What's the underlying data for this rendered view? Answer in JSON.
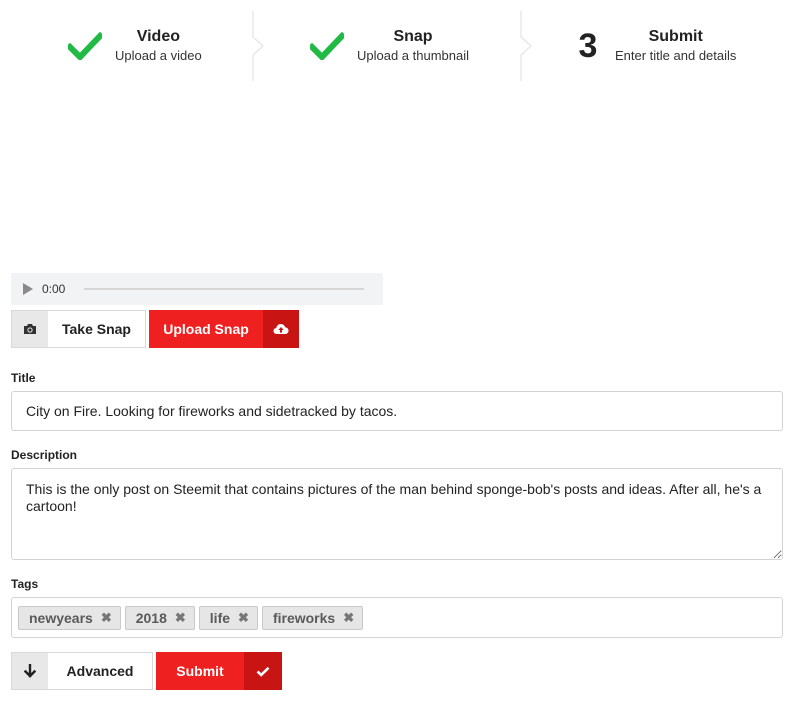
{
  "steps": [
    {
      "icon": "checkmark-icon",
      "title": "Video",
      "description": "Upload a video",
      "completed": true
    },
    {
      "icon": "checkmark-icon",
      "title": "Snap",
      "description": "Upload a thumbnail",
      "completed": true
    },
    {
      "number": "3",
      "title": "Submit",
      "description": "Enter title and details",
      "completed": false
    }
  ],
  "player": {
    "time": "0:00",
    "progress": 0
  },
  "snap": {
    "take_label": "Take Snap",
    "take_icon": "camera-icon",
    "upload_label": "Upload Snap",
    "upload_icon": "cloud-upload-icon"
  },
  "form": {
    "title_label": "Title",
    "title_value": "City on Fire. Looking for fireworks and sidetracked by tacos.",
    "description_label": "Description",
    "description_value": "This is the only post on Steemit that contains pictures of the man behind sponge-bob's posts and ideas. After all, he's a cartoon!",
    "tags_label": "Tags",
    "tags": [
      "newyears",
      "2018",
      "life",
      "fireworks"
    ]
  },
  "actions": {
    "advanced_label": "Advanced",
    "advanced_icon": "arrow-down-icon",
    "submit_label": "Submit",
    "submit_icon": "checkmark-icon"
  },
  "colors": {
    "accent": "#ee2020",
    "accent_dark": "#c91414",
    "success": "#21ba45"
  }
}
